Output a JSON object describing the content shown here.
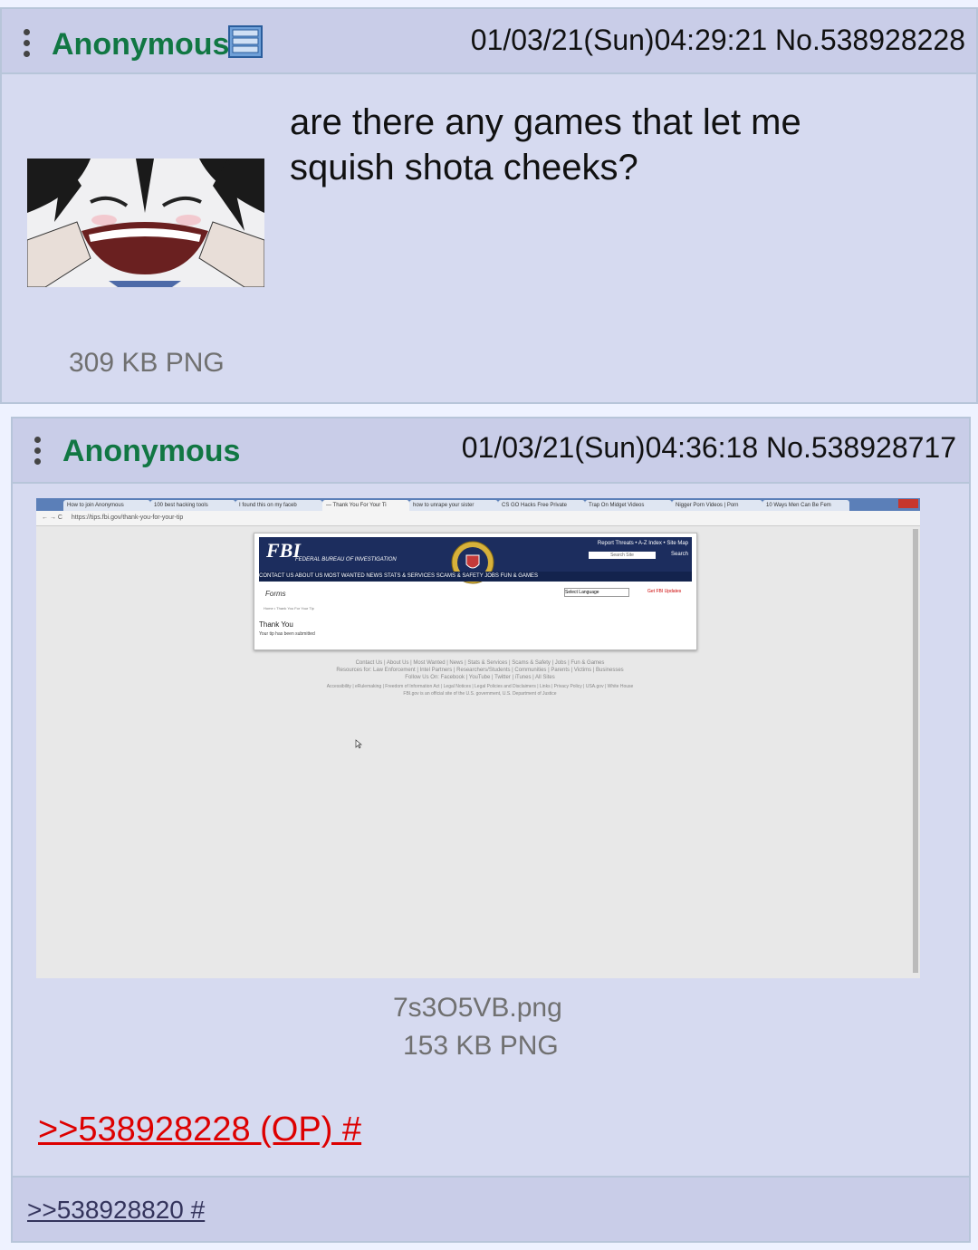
{
  "posts": [
    {
      "name": "Anonymous",
      "datetime": "01/03/21(Sun)04:29:21",
      "number": "No.538928228",
      "comment_line1": "are there any games that let me",
      "comment_line2": "squish shota cheeks?",
      "file_info": "309 KB PNG"
    },
    {
      "name": "Anonymous",
      "datetime": "01/03/21(Sun)04:36:18",
      "number": "No.538928717",
      "filename": "7s3O5VB.png",
      "file_info": "153 KB PNG",
      "quote": ">>538928228 (OP) #"
    }
  ],
  "reply_footer": ">>538928820 #",
  "screenshot": {
    "tabs": [
      "How to join Anonymous",
      "100 best hacking tools",
      "I found this on my faceb",
      "— Thank You For Your Ti",
      "how to unrape your sister",
      "CS GO Hacks Free Private",
      "Trap On Midget Videos",
      "Nigger Porn Videos | Porn",
      "10 Ways Men Can Be Fem"
    ],
    "url": "https://tips.fbi.gov/thank-you-for-your-tip",
    "header_links": "Report Threats • A-Z Index • Site Map",
    "search_placeholder": "Search Site",
    "search_button": "Search",
    "fbi_logo": "FBI",
    "fbi_subtitle": "FEDERAL BUREAU OF INVESTIGATION",
    "nav": "CONTACT US   ABOUT US   MOST WANTED   NEWS   STATS & SERVICES   SCAMS & SAFETY   JOBS   FUN & GAMES",
    "forms_label": "Forms",
    "language_select": "Select Language",
    "updates_link": "Get FBI Updates",
    "breadcrumb": "Home • Thank You For Your Tip",
    "heading": "Thank You",
    "message": "Your tip has been submitted",
    "footer1": "Contact Us | About Us | Most Wanted | News | Stats & Services | Scams & Safety | Jobs | Fun & Games",
    "footer2": "Resources for: Law Enforcement | Intel Partners | Researchers/Students | Communities | Parents | Victims | Businesses",
    "footer3": "Follow Us On: Facebook | YouTube | Twitter | iTunes | All Sites",
    "footer4": "Accessibility | eRulemaking | Freedom of Information Act | Legal Notices | Legal Policies and Disclaimers | Links | Privacy Policy | USA.gov | White House",
    "footer5": "FBI.gov is an official site of the U.S. government, U.S. Department of Justice"
  },
  "colors": {
    "name": "#117743",
    "quote": "#dd0000",
    "post_bg": "#d6daf0"
  },
  "icons": [
    "menu-dots-icon",
    "archive-file-icon",
    "cursor-icon"
  ]
}
